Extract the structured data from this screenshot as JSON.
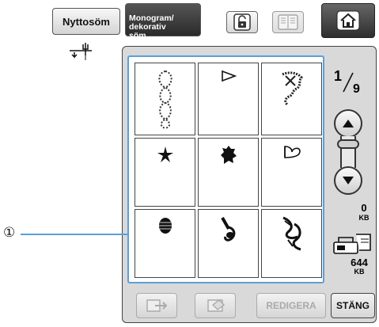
{
  "tabs": {
    "utility_label": "Nyttosöm",
    "monogram_label": "Monogram/\ndekorativ\nsöm"
  },
  "callout": {
    "marker": "①"
  },
  "page_indicator": {
    "current": "1",
    "total": "9"
  },
  "memory": {
    "used_value": "0",
    "used_unit": "KB",
    "free_value": "644",
    "free_unit": "KB"
  },
  "bottom_bar": {
    "edit_label": "REDIGERA",
    "close_label": "STÄNG"
  },
  "stitch_grid": {
    "cells": [
      {
        "icon": "stitch-cross-figure8-icon"
      },
      {
        "icon": "stitch-chevron-icon"
      },
      {
        "icon": "stitch-cross-flower-icon"
      },
      {
        "icon": "stitch-star-icon"
      },
      {
        "icon": "stitch-blob-icon"
      },
      {
        "icon": "stitch-outline-b-icon"
      },
      {
        "icon": "stitch-filled-oval-icon"
      },
      {
        "icon": "stitch-music-note-icon"
      },
      {
        "icon": "stitch-swirl-icon"
      }
    ]
  },
  "colors": {
    "selection_frame": "#5aa0d8",
    "panel_bg": "#d9d9d9",
    "active_tab": "#333333"
  }
}
